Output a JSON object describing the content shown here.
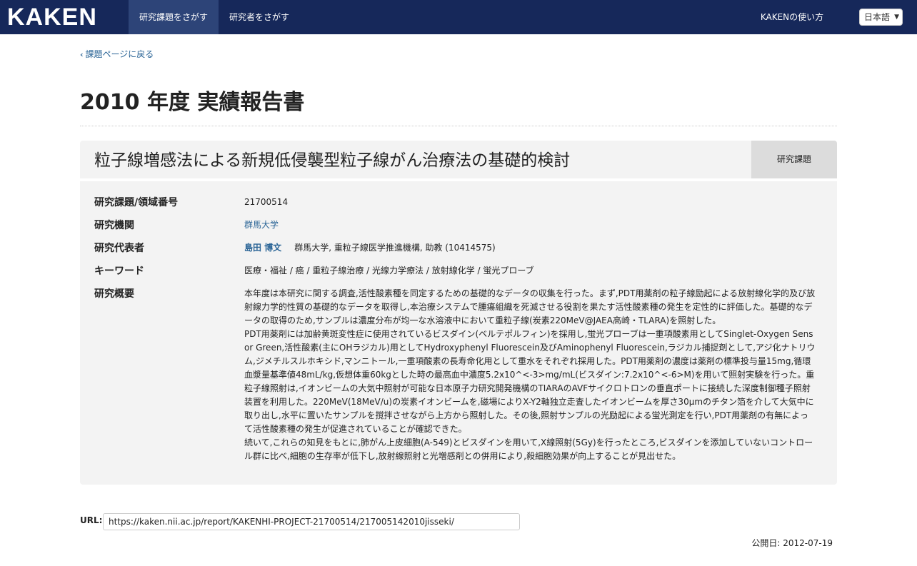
{
  "nav": {
    "logo": "KAKEN",
    "tab_projects": "研究課題をさがす",
    "tab_researchers": "研究者をさがす",
    "help": "KAKENの使い方",
    "language": "日本語"
  },
  "back_link": "課題ページに戻る",
  "report_title": "2010 年度 実績報告書",
  "project": {
    "title": "粒子線増感法による新規低侵襲型粒子線がん治療法の基礎的検討",
    "badge": "研究課題"
  },
  "details": {
    "number_label": "研究課題/領域番号",
    "number": "21700514",
    "institution_label": "研究機関",
    "institution": "群馬大学",
    "pi_label": "研究代表者",
    "pi_name": "島田 博文",
    "pi_affiliation": "群馬大学, 重粒子線医学推進機構, 助教 (10414575)",
    "keywords_label": "キーワード",
    "keywords": "医療・福祉 / 癌 / 重粒子線治療 / 光線力学療法 / 放射線化学 / 蛍光プローブ",
    "summary_label": "研究概要",
    "summary_p1": "本年度は本研究に関する調査,活性酸素種を同定するための基礎的なデータの収集を行った。まず,PDT用薬剤の粒子線励起による放射線化学的及び放射線力学的性質の基礎的なデータを取得し,本治療システムで腫瘍組織を死滅させる役割を果たす活性酸素種の発生を定性的に評価した。基礎的なデータの取得のため,サンプルは濃度分布が均一な水溶液中において重粒子線(炭素220MeV@JAEA高崎・TLARA)を照射した。",
    "summary_p2": "PDT用薬剤には加齢黄斑変性症に使用されているビスダイン(ベルテポルフィン)を採用し,蛍光プローブは一重項酸素用としてSinglet-Oxygen Sensor Green,活性酸素(主にOHラジカル)用としてHydroxyphenyl Fluorescein及びAminophenyl Fluorescein,ラジカル捕捉剤として,アジ化ナトリウム,ジメチルスルホキシド,マンニトール,一重項酸素の長寿命化用として重水をそれぞれ採用した。PDT用薬剤の濃度は薬剤の標準投与量15mg,循環血漿量基準値48mL/kg,仮想体重60kgとした時の最高血中濃度5.2x10^<-3>mg/mL(ビスダイン:7.2x10^<-6>M)を用いて照射実験を行った。重粒子線照射は,イオンビームの大気中照射が可能な日本原子力研究開発機構のTIARAのAVFサイクロトロンの垂直ポートに接続した深度制御種子照射装置を利用した。220MeV(18MeV/u)の炭素イオンビームを,磁場によりX-Y2軸独立走査したイオンビームを厚さ30μmのチタン箔を介して大気中に取り出し,水平に置いたサンプルを撹拌させながら上方から照射した。その後,照射サンプルの光励起による蛍光測定を行い,PDT用薬剤の有無によって活性酸素種の発生が促進されていることが確認できた。",
    "summary_p3": "続いて,これらの知見をもとに,肺がん上皮細胞(A-549)とビスダインを用いて,X線照射(5Gy)を行ったところ,ビスダインを添加していないコントロール群に比べ,細胞の生存率が低下し,放射線照射と光増感剤との併用により,殺細胞効果が向上することが見出せた。"
  },
  "url": {
    "label": "URL:",
    "value": "https://kaken.nii.ac.jp/report/KAKENHI-PROJECT-21700514/217005142010jisseki/"
  },
  "published": "公開日: 2012-07-19"
}
